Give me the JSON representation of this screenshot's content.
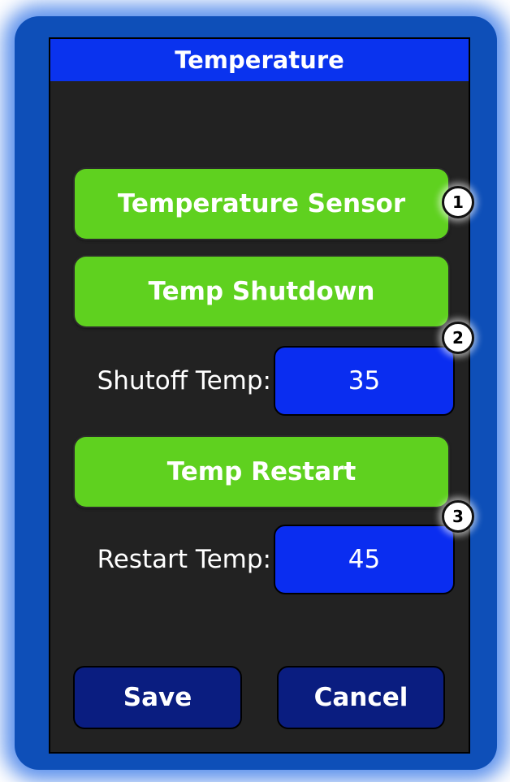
{
  "header": {
    "title": "Temperature"
  },
  "buttons": {
    "temperature_sensor": "Temperature Sensor",
    "temp_shutdown": "Temp Shutdown",
    "temp_restart": "Temp Restart",
    "save": "Save",
    "cancel": "Cancel"
  },
  "fields": {
    "shutoff_label": "Shutoff Temp:",
    "shutoff_value": "35",
    "restart_label": "Restart Temp:",
    "restart_value": "45"
  },
  "callouts": [
    "1",
    "2",
    "3"
  ],
  "colors": {
    "title_bar": "#0a33ee",
    "green_button": "#5fd11f",
    "value_box": "#0a2df0",
    "bottom_button": "#0a1d80",
    "screen_bg": "#222222"
  }
}
